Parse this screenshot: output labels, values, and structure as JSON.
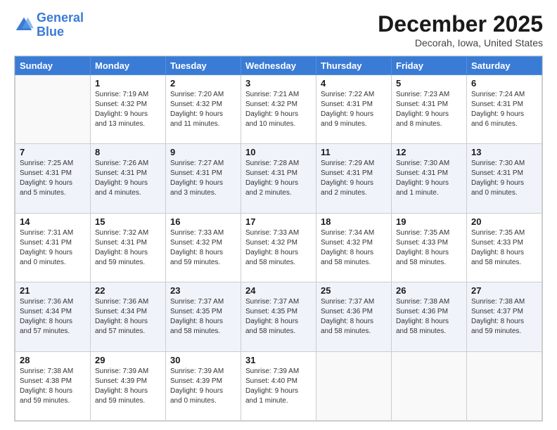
{
  "logo": {
    "line1": "General",
    "line2": "Blue"
  },
  "header": {
    "title": "December 2025",
    "subtitle": "Decorah, Iowa, United States"
  },
  "weekdays": [
    "Sunday",
    "Monday",
    "Tuesday",
    "Wednesday",
    "Thursday",
    "Friday",
    "Saturday"
  ],
  "weeks": [
    [
      {
        "day": "",
        "sunrise": "",
        "sunset": "",
        "daylight": ""
      },
      {
        "day": "1",
        "sunrise": "Sunrise: 7:19 AM",
        "sunset": "Sunset: 4:32 PM",
        "daylight": "Daylight: 9 hours and 13 minutes."
      },
      {
        "day": "2",
        "sunrise": "Sunrise: 7:20 AM",
        "sunset": "Sunset: 4:32 PM",
        "daylight": "Daylight: 9 hours and 11 minutes."
      },
      {
        "day": "3",
        "sunrise": "Sunrise: 7:21 AM",
        "sunset": "Sunset: 4:32 PM",
        "daylight": "Daylight: 9 hours and 10 minutes."
      },
      {
        "day": "4",
        "sunrise": "Sunrise: 7:22 AM",
        "sunset": "Sunset: 4:31 PM",
        "daylight": "Daylight: 9 hours and 9 minutes."
      },
      {
        "day": "5",
        "sunrise": "Sunrise: 7:23 AM",
        "sunset": "Sunset: 4:31 PM",
        "daylight": "Daylight: 9 hours and 8 minutes."
      },
      {
        "day": "6",
        "sunrise": "Sunrise: 7:24 AM",
        "sunset": "Sunset: 4:31 PM",
        "daylight": "Daylight: 9 hours and 6 minutes."
      }
    ],
    [
      {
        "day": "7",
        "sunrise": "Sunrise: 7:25 AM",
        "sunset": "Sunset: 4:31 PM",
        "daylight": "Daylight: 9 hours and 5 minutes."
      },
      {
        "day": "8",
        "sunrise": "Sunrise: 7:26 AM",
        "sunset": "Sunset: 4:31 PM",
        "daylight": "Daylight: 9 hours and 4 minutes."
      },
      {
        "day": "9",
        "sunrise": "Sunrise: 7:27 AM",
        "sunset": "Sunset: 4:31 PM",
        "daylight": "Daylight: 9 hours and 3 minutes."
      },
      {
        "day": "10",
        "sunrise": "Sunrise: 7:28 AM",
        "sunset": "Sunset: 4:31 PM",
        "daylight": "Daylight: 9 hours and 2 minutes."
      },
      {
        "day": "11",
        "sunrise": "Sunrise: 7:29 AM",
        "sunset": "Sunset: 4:31 PM",
        "daylight": "Daylight: 9 hours and 2 minutes."
      },
      {
        "day": "12",
        "sunrise": "Sunrise: 7:30 AM",
        "sunset": "Sunset: 4:31 PM",
        "daylight": "Daylight: 9 hours and 1 minute."
      },
      {
        "day": "13",
        "sunrise": "Sunrise: 7:30 AM",
        "sunset": "Sunset: 4:31 PM",
        "daylight": "Daylight: 9 hours and 0 minutes."
      }
    ],
    [
      {
        "day": "14",
        "sunrise": "Sunrise: 7:31 AM",
        "sunset": "Sunset: 4:31 PM",
        "daylight": "Daylight: 9 hours and 0 minutes."
      },
      {
        "day": "15",
        "sunrise": "Sunrise: 7:32 AM",
        "sunset": "Sunset: 4:31 PM",
        "daylight": "Daylight: 8 hours and 59 minutes."
      },
      {
        "day": "16",
        "sunrise": "Sunrise: 7:33 AM",
        "sunset": "Sunset: 4:32 PM",
        "daylight": "Daylight: 8 hours and 59 minutes."
      },
      {
        "day": "17",
        "sunrise": "Sunrise: 7:33 AM",
        "sunset": "Sunset: 4:32 PM",
        "daylight": "Daylight: 8 hours and 58 minutes."
      },
      {
        "day": "18",
        "sunrise": "Sunrise: 7:34 AM",
        "sunset": "Sunset: 4:32 PM",
        "daylight": "Daylight: 8 hours and 58 minutes."
      },
      {
        "day": "19",
        "sunrise": "Sunrise: 7:35 AM",
        "sunset": "Sunset: 4:33 PM",
        "daylight": "Daylight: 8 hours and 58 minutes."
      },
      {
        "day": "20",
        "sunrise": "Sunrise: 7:35 AM",
        "sunset": "Sunset: 4:33 PM",
        "daylight": "Daylight: 8 hours and 58 minutes."
      }
    ],
    [
      {
        "day": "21",
        "sunrise": "Sunrise: 7:36 AM",
        "sunset": "Sunset: 4:34 PM",
        "daylight": "Daylight: 8 hours and 57 minutes."
      },
      {
        "day": "22",
        "sunrise": "Sunrise: 7:36 AM",
        "sunset": "Sunset: 4:34 PM",
        "daylight": "Daylight: 8 hours and 57 minutes."
      },
      {
        "day": "23",
        "sunrise": "Sunrise: 7:37 AM",
        "sunset": "Sunset: 4:35 PM",
        "daylight": "Daylight: 8 hours and 58 minutes."
      },
      {
        "day": "24",
        "sunrise": "Sunrise: 7:37 AM",
        "sunset": "Sunset: 4:35 PM",
        "daylight": "Daylight: 8 hours and 58 minutes."
      },
      {
        "day": "25",
        "sunrise": "Sunrise: 7:37 AM",
        "sunset": "Sunset: 4:36 PM",
        "daylight": "Daylight: 8 hours and 58 minutes."
      },
      {
        "day": "26",
        "sunrise": "Sunrise: 7:38 AM",
        "sunset": "Sunset: 4:36 PM",
        "daylight": "Daylight: 8 hours and 58 minutes."
      },
      {
        "day": "27",
        "sunrise": "Sunrise: 7:38 AM",
        "sunset": "Sunset: 4:37 PM",
        "daylight": "Daylight: 8 hours and 59 minutes."
      }
    ],
    [
      {
        "day": "28",
        "sunrise": "Sunrise: 7:38 AM",
        "sunset": "Sunset: 4:38 PM",
        "daylight": "Daylight: 8 hours and 59 minutes."
      },
      {
        "day": "29",
        "sunrise": "Sunrise: 7:39 AM",
        "sunset": "Sunset: 4:39 PM",
        "daylight": "Daylight: 8 hours and 59 minutes."
      },
      {
        "day": "30",
        "sunrise": "Sunrise: 7:39 AM",
        "sunset": "Sunset: 4:39 PM",
        "daylight": "Daylight: 9 hours and 0 minutes."
      },
      {
        "day": "31",
        "sunrise": "Sunrise: 7:39 AM",
        "sunset": "Sunset: 4:40 PM",
        "daylight": "Daylight: 9 hours and 1 minute."
      },
      {
        "day": "",
        "sunrise": "",
        "sunset": "",
        "daylight": ""
      },
      {
        "day": "",
        "sunrise": "",
        "sunset": "",
        "daylight": ""
      },
      {
        "day": "",
        "sunrise": "",
        "sunset": "",
        "daylight": ""
      }
    ]
  ]
}
